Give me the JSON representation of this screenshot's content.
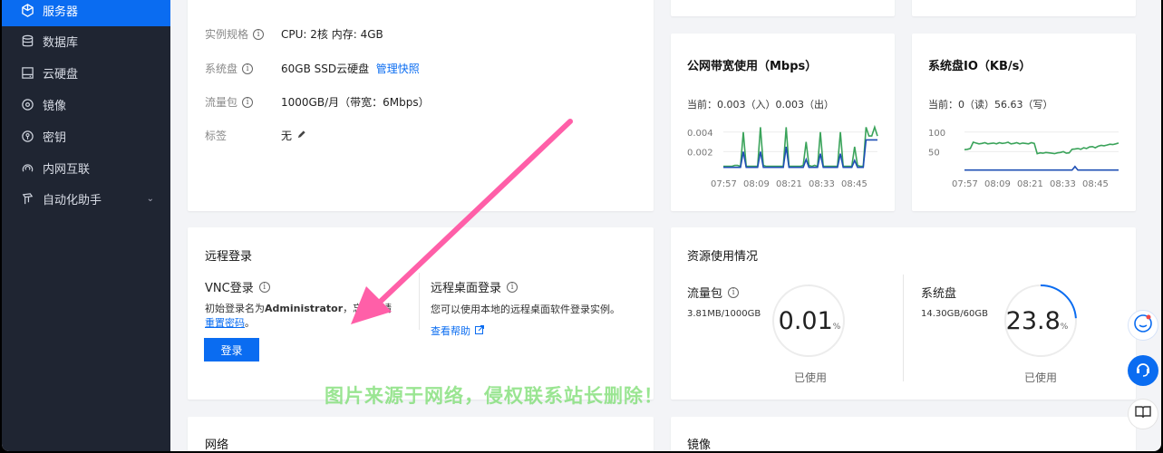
{
  "sidebar": {
    "items": [
      {
        "label": "服务器",
        "icon": "server-icon",
        "active": true
      },
      {
        "label": "数据库",
        "icon": "database-icon"
      },
      {
        "label": "云硬盘",
        "icon": "disk-icon"
      },
      {
        "label": "镜像",
        "icon": "image-icon"
      },
      {
        "label": "密钥",
        "icon": "key-icon"
      },
      {
        "label": "内网互联",
        "icon": "network-icon"
      },
      {
        "label": "自动化助手",
        "icon": "automation-icon"
      }
    ]
  },
  "config": {
    "spec_label": "实例规格",
    "spec_value": "CPU: 2核 内存: 4GB",
    "disk_label": "系统盘",
    "disk_value": "60GB SSD云硬盘",
    "disk_link": "管理快照",
    "traffic_label": "流量包",
    "traffic_value": "1000GB/月（带宽：6Mbps）",
    "tag_label": "标签",
    "tag_value": "无"
  },
  "bandwidth_chart": {
    "title": "公网带宽使用（Mbps）",
    "current": "当前：0.003（入）0.003（出）",
    "chart_data": {
      "type": "line",
      "x_ticks": [
        "07:57",
        "08:09",
        "08:21",
        "08:33",
        "08:45"
      ],
      "y_ticks": [
        "0.004",
        "0.002"
      ],
      "series": [
        {
          "color": "#3aa35a",
          "values": [
            0.0005,
            0.0005,
            0.0005,
            0.0005,
            0.0006,
            0.0006,
            0.0005,
            0.004,
            0.0005,
            0.0005,
            0.0005,
            0.0005,
            0.0005,
            0.0045,
            0.0006,
            0.0005,
            0.0005,
            0.0005,
            0.0005,
            0.0005,
            0.0005,
            0.0005,
            0.0045,
            0.0005,
            0.0005,
            0.0005,
            0.0005,
            0.0005,
            0.0006,
            0.003,
            0.0006,
            0.0005,
            0.0006,
            0.0005,
            0.004,
            0.0005,
            0.0005,
            0.0005,
            0.0005,
            0.0005,
            0.0005,
            0.004,
            0.0005,
            0.0005,
            0.0005,
            0.0005,
            0.0025,
            0.0006,
            0.0005,
            0.0005,
            0.0045,
            0.0036,
            0.0036,
            0.0045,
            0.0036
          ]
        },
        {
          "color": "#1f4fb5",
          "values": [
            0.0004,
            0.0004,
            0.0004,
            0.0004,
            0.0004,
            0.0004,
            0.0004,
            0.002,
            0.0004,
            0.0004,
            0.0004,
            0.0004,
            0.0004,
            0.002,
            0.0004,
            0.0004,
            0.0004,
            0.0004,
            0.0004,
            0.0004,
            0.0004,
            0.0004,
            0.0025,
            0.0004,
            0.0004,
            0.0004,
            0.0004,
            0.0004,
            0.0004,
            0.0012,
            0.0004,
            0.0004,
            0.0004,
            0.0004,
            0.0018,
            0.0004,
            0.0004,
            0.0004,
            0.0004,
            0.0004,
            0.0004,
            0.0018,
            0.0004,
            0.0004,
            0.0004,
            0.0004,
            0.0011,
            0.0004,
            0.0004,
            0.0004,
            0.0032,
            0.0032,
            0.0032,
            0.0032,
            0.0032
          ]
        }
      ]
    }
  },
  "diskio_chart": {
    "title": "系统盘IO（KB/s）",
    "current": "当前：0（读）56.63（写）",
    "chart_data": {
      "type": "line",
      "x_ticks": [
        "07:57",
        "08:09",
        "08:21",
        "08:33",
        "08:45"
      ],
      "y_ticks": [
        "100",
        "50"
      ],
      "series": [
        {
          "color": "#3aa35a",
          "values": [
            55,
            56,
            58,
            74,
            72,
            70,
            71,
            73,
            70,
            71,
            72,
            70,
            73,
            71,
            72,
            74,
            70,
            71,
            73,
            70,
            72,
            71,
            70,
            73,
            71,
            45,
            47,
            46,
            48,
            47,
            46,
            45,
            47,
            48,
            50,
            46,
            47,
            56,
            57,
            58,
            56,
            60,
            58,
            62,
            63,
            60,
            64,
            66,
            65,
            67,
            69,
            68,
            70,
            72
          ]
        },
        {
          "color": "#1f4fb5",
          "values": [
            3,
            3,
            3,
            3,
            3,
            3,
            3,
            3,
            3,
            3,
            3,
            3,
            3,
            3,
            3,
            3,
            3,
            3,
            3,
            3,
            3,
            3,
            3,
            3,
            3,
            3,
            3,
            3,
            3,
            3,
            3,
            3,
            3,
            3,
            3,
            3,
            3,
            3,
            12,
            3,
            3,
            3,
            3,
            3,
            3,
            3,
            3,
            3,
            3,
            3,
            3,
            3,
            3,
            3
          ]
        }
      ]
    }
  },
  "remote_login": {
    "title": "远程登录",
    "vnc_title": "VNC登录",
    "vnc_desc_prefix": "初始登录名为",
    "vnc_desc_bold": "Administrator",
    "vnc_desc_suffix": "，忘",
    "vnc_desc_tail": "请",
    "reset_link": "重置密码",
    "reset_suffix": "。",
    "login_button": "登录",
    "rdp_title": "远程桌面登录",
    "rdp_desc": "您可以使用本地的远程桌面软件登录实例。",
    "rdp_link": "查看帮助"
  },
  "usage": {
    "title": "资源使用情况",
    "traffic_title": "流量包",
    "traffic_amount": "3.81MB/1000GB",
    "traffic_percent": "0.01",
    "traffic_fraction": 0.0001,
    "disk_title": "系统盘",
    "disk_amount": "14.30GB/60GB",
    "disk_percent": "23.8",
    "disk_fraction": 0.238,
    "percent_sign": "%",
    "used_label": "已使用"
  },
  "bottom": {
    "network_title": "网络",
    "mirror_title": "镜像"
  },
  "watermark": "图片来源于网络，侵权联系站长删除！"
}
